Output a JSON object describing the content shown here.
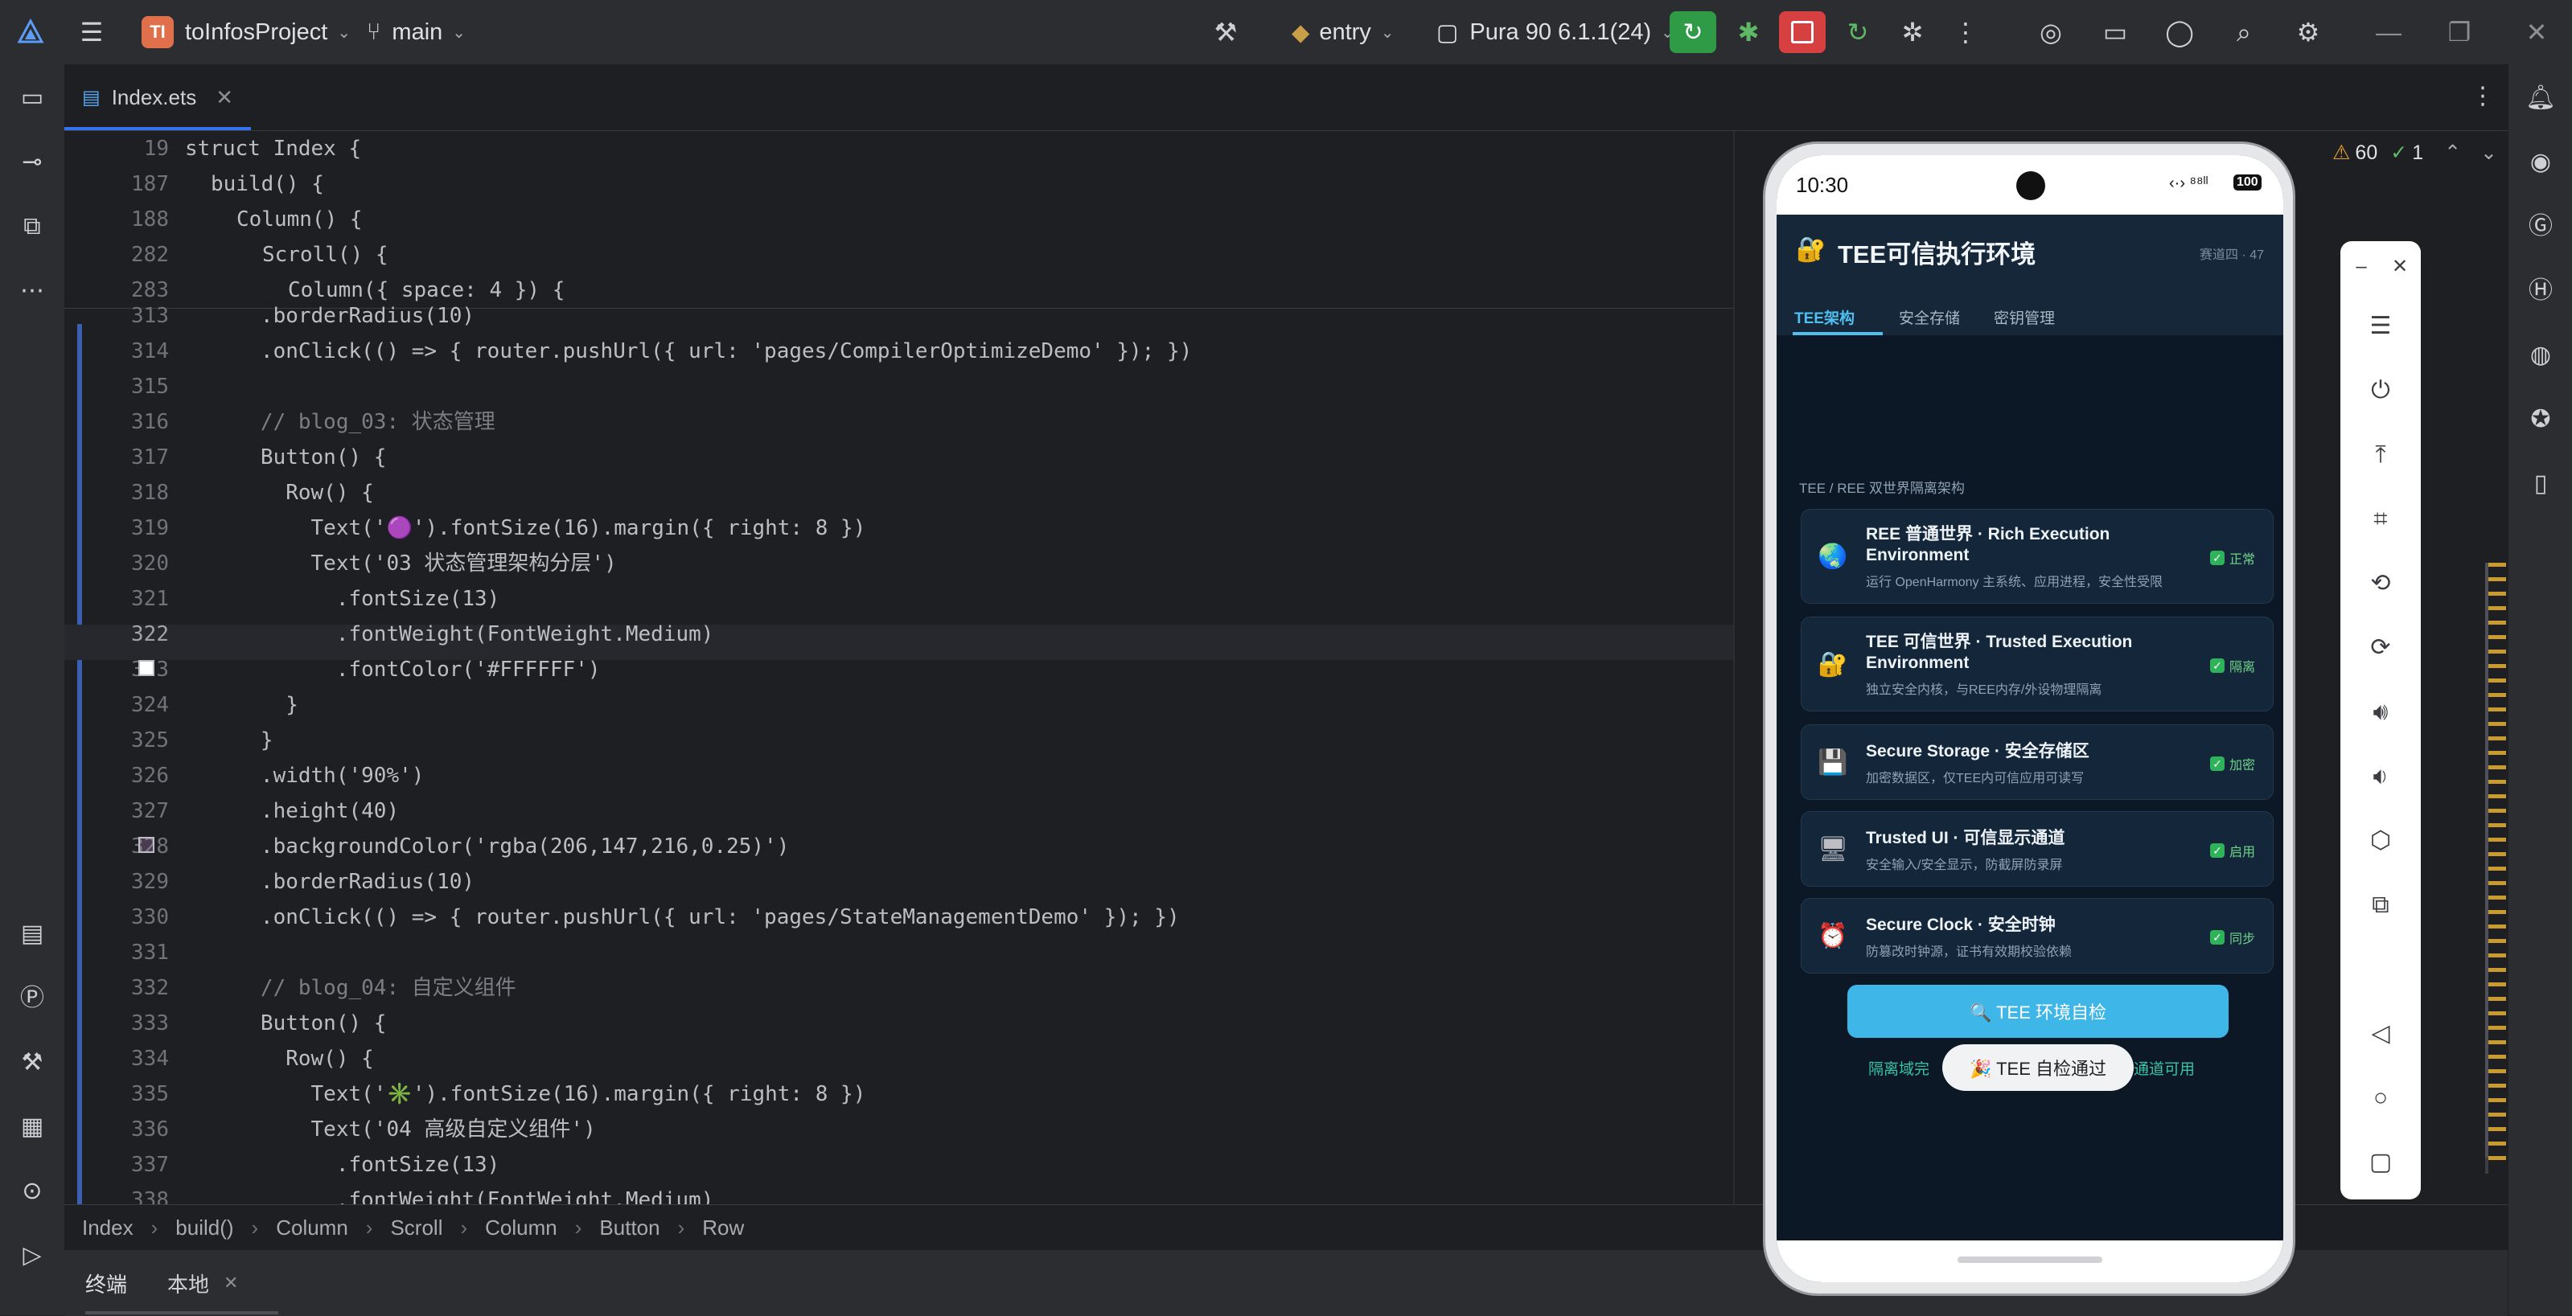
{
  "titlebar": {
    "project_initials": "TI",
    "project_name": "toInfosProject",
    "branch": "main",
    "run_config": "entry",
    "device": "Pura 90 6.1.1(24)",
    "icons": [
      "app-logo-icon",
      "hamburger-menu-icon",
      "branch-icon",
      "build-hammer-icon",
      "run-config-icon",
      "device-icon",
      "rerun-icon",
      "debug-icon",
      "stop-icon",
      "apply-changes-icon",
      "attach-debugger-icon",
      "more-vertical-icon",
      "target-icon",
      "project-folder-icon",
      "account-icon",
      "search-icon",
      "settings-icon",
      "minimize-icon",
      "restore-icon",
      "close-icon"
    ]
  },
  "tab": {
    "filename": "Index.ets"
  },
  "inspection": {
    "warnings": "60",
    "weak_warnings": "1"
  },
  "sticky_lines": [
    {
      "num": "19",
      "indent": 0,
      "code": "struct Index {"
    },
    {
      "num": "187",
      "indent": 1,
      "code": "build() {"
    },
    {
      "num": "188",
      "indent": 2,
      "code": "Column() {"
    },
    {
      "num": "282",
      "indent": 3,
      "code": "Scroll() {"
    },
    {
      "num": "283",
      "indent": 4,
      "code": "Column({ space: 4 }) {"
    }
  ],
  "code_lines": [
    {
      "num": "313",
      "text": "      .borderRadius(10)"
    },
    {
      "num": "314",
      "text": "      .onClick(() => { router.pushUrl({ url: 'pages/CompilerOptimizeDemo' }); })"
    },
    {
      "num": "315",
      "text": ""
    },
    {
      "num": "316",
      "text": "      // blog_03: 状态管理"
    },
    {
      "num": "317",
      "text": "      Button() {"
    },
    {
      "num": "318",
      "text": "        Row() {"
    },
    {
      "num": "319",
      "text": "          Text('🟣').fontSize(16).margin({ right: 8 })"
    },
    {
      "num": "320",
      "text": "          Text('03 状态管理架构分层')"
    },
    {
      "num": "321",
      "text": "            .fontSize(13)"
    },
    {
      "num": "322",
      "text": "            .fontWeight(FontWeight.Medium)"
    },
    {
      "num": "323",
      "text": "            .fontColor('#FFFFFF')"
    },
    {
      "num": "324",
      "text": "        }"
    },
    {
      "num": "325",
      "text": "      }"
    },
    {
      "num": "326",
      "text": "      .width('90%')"
    },
    {
      "num": "327",
      "text": "      .height(40)"
    },
    {
      "num": "328",
      "text": "      .backgroundColor('rgba(206,147,216,0.25)')"
    },
    {
      "num": "329",
      "text": "      .borderRadius(10)"
    },
    {
      "num": "330",
      "text": "      .onClick(() => { router.pushUrl({ url: 'pages/StateManagementDemo' }); })"
    },
    {
      "num": "331",
      "text": ""
    },
    {
      "num": "332",
      "text": "      // blog_04: 自定义组件"
    },
    {
      "num": "333",
      "text": "      Button() {"
    },
    {
      "num": "334",
      "text": "        Row() {"
    },
    {
      "num": "335",
      "text": "          Text('✳️').fontSize(16).margin({ right: 8 })"
    },
    {
      "num": "336",
      "text": "          Text('04 高级自定义组件')"
    },
    {
      "num": "337",
      "text": "            .fontSize(13)"
    },
    {
      "num": "338",
      "text": "            .fontWeight(FontWeight.Medium)"
    }
  ],
  "breadcrumb": [
    "Index",
    "build()",
    "Column",
    "Scroll",
    "Column",
    "Button",
    "Row"
  ],
  "bottom_tabs": {
    "terminal": "终端",
    "local": "本地"
  },
  "phone": {
    "time": "10:30",
    "battery": "100",
    "app_title": "TEE可信执行环境",
    "header_meta": "赛道四 · 47",
    "tabs": [
      "TEE架构",
      "安全存储",
      "密钥管理"
    ],
    "section_label": "TEE / REE 双世界隔离架构",
    "cards": [
      {
        "icon": "🌏",
        "title": "REE 普通世界 · Rich Execution Environment",
        "sub": "运行 OpenHarmony 主系统、应用进程，安全性受限",
        "status": "正常"
      },
      {
        "icon": "🔐",
        "title": "TEE 可信世界 · Trusted Execution Environment",
        "sub": "独立安全内核，与REE内存/外设物理隔离",
        "status": "隔离"
      },
      {
        "icon": "💾",
        "title": "Secure Storage · 安全存储区",
        "sub": "加密数据区，仅TEE内可信应用可读写",
        "status": "加密"
      },
      {
        "icon": "🖥",
        "title": "Trusted UI · 可信显示通道",
        "sub": "安全输入/安全显示，防截屏防录屏",
        "status": "启用"
      },
      {
        "icon": "⏰",
        "title": "Secure Clock · 安全时钟",
        "sub": "防篡改时钟源，证书有效期校验依赖",
        "status": "同步"
      }
    ],
    "check_button": "🔍 TEE 环境自检",
    "result_left": "隔离域完",
    "result_right": "通道可用",
    "toast": "🎉 TEE 自检通过"
  },
  "colors": {
    "accent": "#3574f0",
    "phone_button": "#3fb6e8",
    "ok_green": "#2fb35a",
    "editor_bg": "#1e1f22"
  }
}
